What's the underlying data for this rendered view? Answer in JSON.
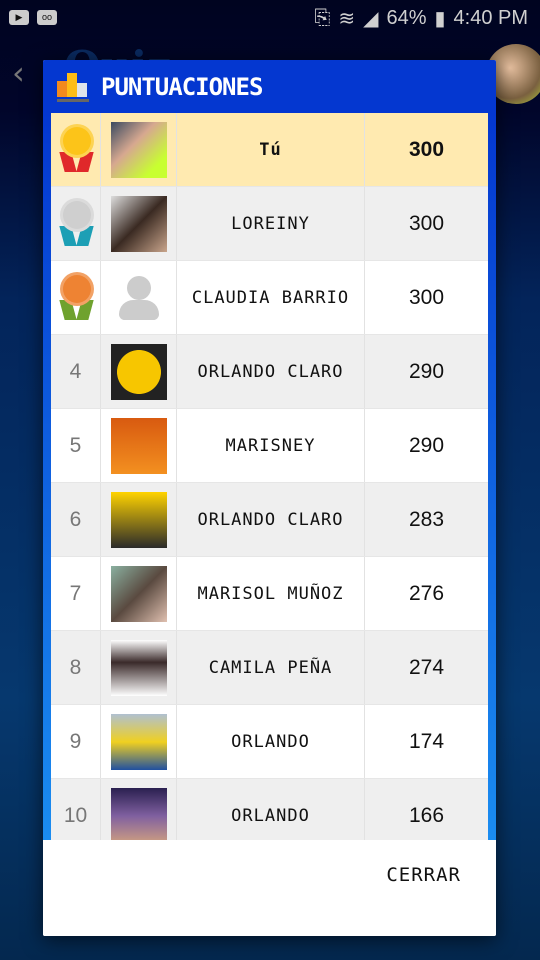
{
  "status": {
    "battery": "64%",
    "time": "4:40 PM"
  },
  "appbar": {
    "title": "Quiz"
  },
  "dialog": {
    "title": "PUNTUACIONES",
    "close_label": "CERRAR"
  },
  "rows": [
    {
      "rank": "",
      "medal": "gold",
      "name": "Tú",
      "score": "300",
      "me": true
    },
    {
      "rank": "",
      "medal": "silver",
      "name": "LOREINY",
      "score": "300"
    },
    {
      "rank": "",
      "medal": "bronze",
      "name": "CLAUDIA BARRIO",
      "score": "300"
    },
    {
      "rank": "4",
      "name": "ORLANDO CLARO",
      "score": "290"
    },
    {
      "rank": "5",
      "name": "MARISNEY",
      "score": "290"
    },
    {
      "rank": "6",
      "name": "ORLANDO CLARO",
      "score": "283"
    },
    {
      "rank": "7",
      "name": "MARISOL MUÑOZ",
      "score": "276"
    },
    {
      "rank": "8",
      "name": "CAMILA PEÑA",
      "score": "274"
    },
    {
      "rank": "9",
      "name": "ORLANDO",
      "score": "174"
    },
    {
      "rank": "10",
      "name": "ORLANDO",
      "score": "166"
    }
  ],
  "colors": {
    "header": "#0437d0",
    "me_row": "#ffeab0"
  }
}
